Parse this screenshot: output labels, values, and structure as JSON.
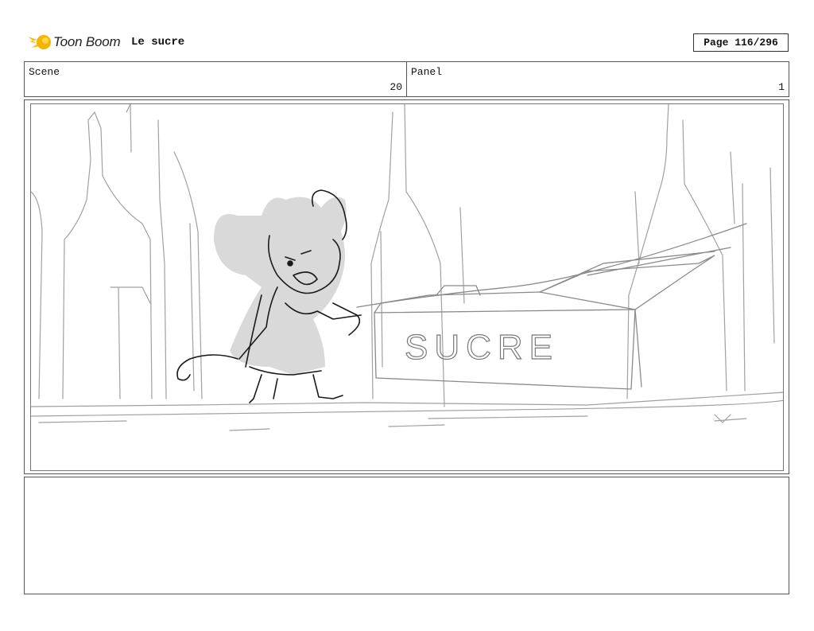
{
  "header": {
    "brand": "Toon Boom",
    "project_title": "Le sucre",
    "page_label": "Page 116/296"
  },
  "info": {
    "scene_label": "Scene",
    "scene_value": "20",
    "panel_label": "Panel",
    "panel_value": "1"
  },
  "sketch": {
    "box_text": "SUCRE"
  },
  "colors": {
    "logo_accent": "#f5b400",
    "sketch_line": "#9a9a9a",
    "character_fill": "#d9d9d9"
  }
}
